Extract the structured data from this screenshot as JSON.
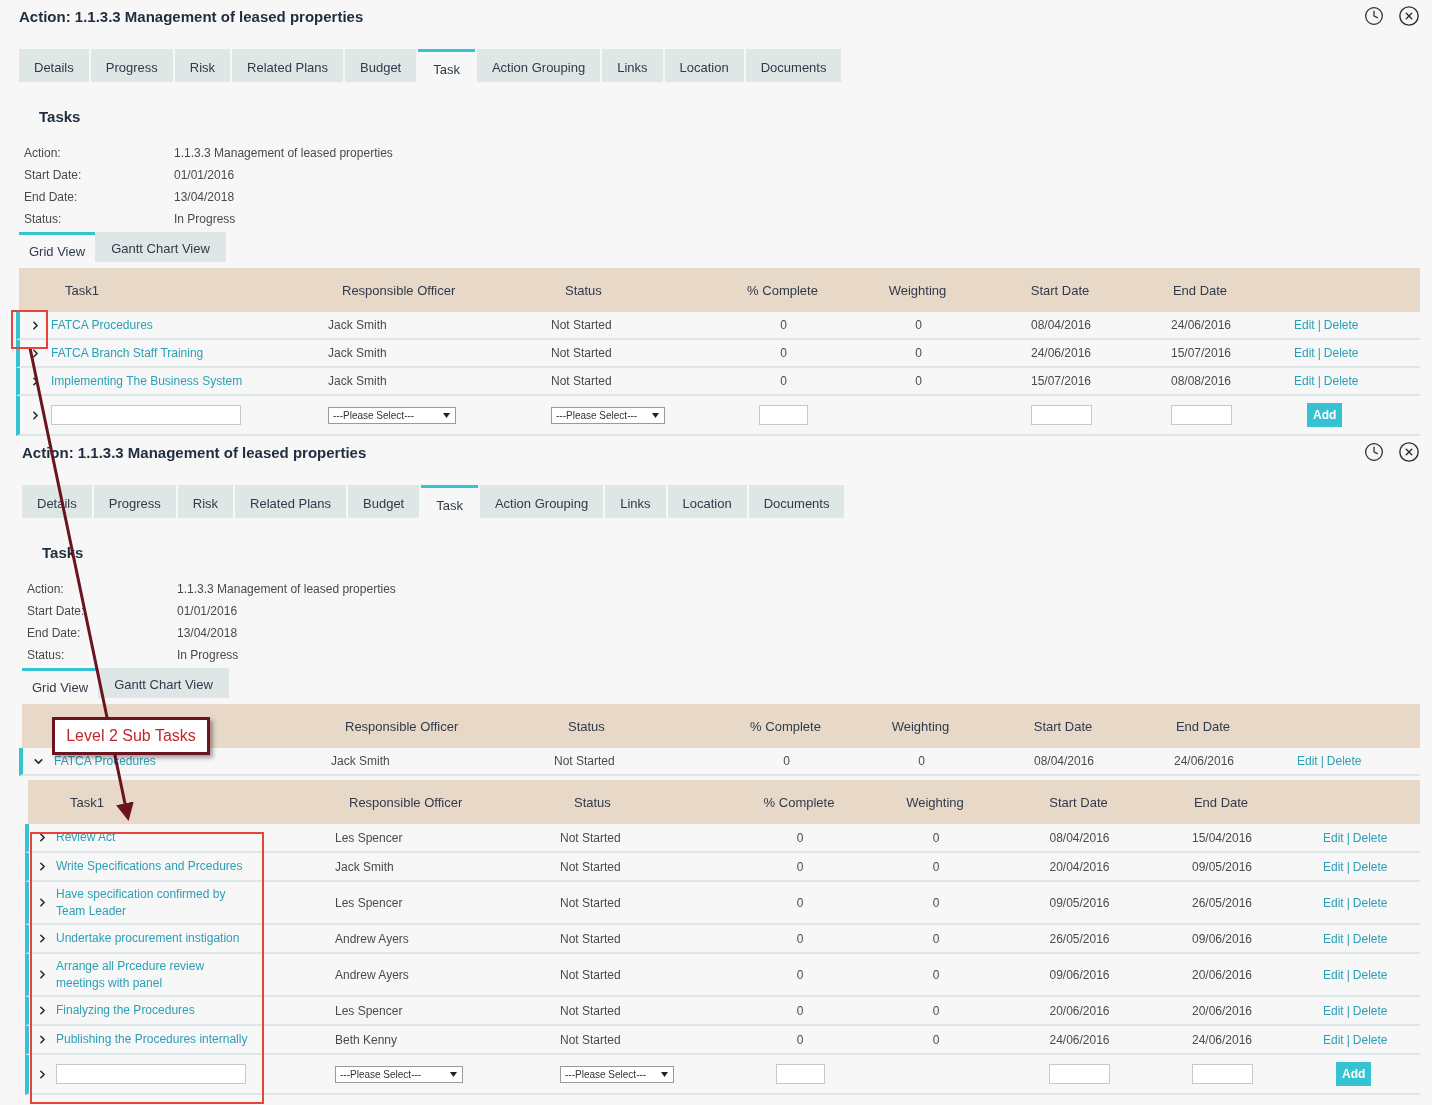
{
  "panels": [
    {
      "title": "Action: 1.1.3.3 Management of leased properties",
      "tabs": [
        {
          "label": "Details",
          "selected": false
        },
        {
          "label": "Progress",
          "selected": false
        },
        {
          "label": "Risk",
          "selected": false
        },
        {
          "label": "Related Plans",
          "selected": false
        },
        {
          "label": "Budget",
          "selected": false
        },
        {
          "label": "Task",
          "selected": true
        },
        {
          "label": "Action Grouping",
          "selected": false
        },
        {
          "label": "Links",
          "selected": false
        },
        {
          "label": "Location",
          "selected": false
        },
        {
          "label": "Documents",
          "selected": false
        }
      ],
      "section_title": "Tasks",
      "info": [
        {
          "label": "Action:",
          "value": "1.1.3.3 Management of leased properties"
        },
        {
          "label": "Start Date:",
          "value": "01/01/2016"
        },
        {
          "label": "End Date:",
          "value": "13/04/2018"
        },
        {
          "label": "Status:",
          "value": "In Progress"
        }
      ],
      "view_tabs": [
        {
          "label": "Grid View",
          "selected": true
        },
        {
          "label": "Gantt Chart View",
          "selected": false
        }
      ],
      "table": {
        "name_column": "Task1",
        "columns": [
          "Responsible Officer",
          "Status",
          "% Complete",
          "Weighting",
          "Start Date",
          "End Date"
        ],
        "rows": [
          {
            "name": "FATCA Procedures",
            "officer": "Jack Smith",
            "status": "Not Started",
            "complete": "0",
            "weighting": "0",
            "start": "08/04/2016",
            "end": "24/06/2016",
            "expanded": false,
            "actions": {
              "edit": "Edit",
              "separator": "|",
              "delete": "Delete"
            }
          },
          {
            "name": "FATCA Branch Staff Training",
            "officer": "Jack Smith",
            "status": "Not Started",
            "complete": "0",
            "weighting": "0",
            "start": "24/06/2016",
            "end": "15/07/2016",
            "expanded": false,
            "actions": {
              "edit": "Edit",
              "separator": "|",
              "delete": "Delete"
            }
          },
          {
            "name": "Implementing The Business System",
            "officer": "Jack Smith",
            "status": "Not Started",
            "complete": "0",
            "weighting": "0",
            "start": "15/07/2016",
            "end": "08/08/2016",
            "expanded": false,
            "actions": {
              "edit": "Edit",
              "separator": "|",
              "delete": "Delete"
            }
          }
        ],
        "new_row": {
          "expanded": false,
          "officer_select": "---Please Select---",
          "status_select": "---Please Select---",
          "button": "Add"
        }
      }
    },
    {
      "title": "Action: 1.1.3.3 Management of leased properties",
      "tabs": [
        {
          "label": "Details",
          "selected": false
        },
        {
          "label": "Progress",
          "selected": false
        },
        {
          "label": "Risk",
          "selected": false
        },
        {
          "label": "Related Plans",
          "selected": false
        },
        {
          "label": "Budget",
          "selected": false
        },
        {
          "label": "Task",
          "selected": true
        },
        {
          "label": "Action Grouping",
          "selected": false
        },
        {
          "label": "Links",
          "selected": false
        },
        {
          "label": "Location",
          "selected": false
        },
        {
          "label": "Documents",
          "selected": false
        }
      ],
      "section_title": "Tasks",
      "info": [
        {
          "label": "Action:",
          "value": "1.1.3.3 Management of leased properties"
        },
        {
          "label": "Start Date:",
          "value": "01/01/2016"
        },
        {
          "label": "End Date:",
          "value": "13/04/2018"
        },
        {
          "label": "Status:",
          "value": "In Progress"
        }
      ],
      "view_tabs": [
        {
          "label": "Grid View",
          "selected": true
        },
        {
          "label": "Gantt Chart View",
          "selected": false
        }
      ],
      "table": {
        "columns": [
          "Responsible Officer",
          "Status",
          "% Complete",
          "Weighting",
          "Start Date",
          "End Date"
        ],
        "rows": [
          {
            "name": "FATCA Procedures",
            "officer": "Jack Smith",
            "status": "Not Started",
            "complete": "0",
            "weighting": "0",
            "start": "08/04/2016",
            "end": "24/06/2016",
            "expanded": true,
            "actions": {
              "edit": "Edit",
              "separator": "|",
              "delete": "Delete"
            },
            "subtable": {
              "name_column": "Task1",
              "columns": [
                "Responsible Officer",
                "Status",
                "% Complete",
                "Weighting",
                "Start Date",
                "End Date"
              ],
              "rows": [
                {
                  "name": "Review Act",
                  "officer": "Les Spencer",
                  "status": "Not Started",
                  "complete": "0",
                  "weighting": "0",
                  "start": "08/04/2016",
                  "end": "15/04/2016",
                  "expanded": false,
                  "actions": {
                    "edit": "Edit",
                    "separator": "|",
                    "delete": "Delete"
                  }
                },
                {
                  "name": "Write Specifications and Prcedures",
                  "officer": "Jack Smith",
                  "status": "Not Started",
                  "complete": "0",
                  "weighting": "0",
                  "start": "20/04/2016",
                  "end": "09/05/2016",
                  "expanded": false,
                  "actions": {
                    "edit": "Edit",
                    "separator": "|",
                    "delete": "Delete"
                  }
                },
                {
                  "name": "Have specification confirmed by Team Leader",
                  "officer": "Les Spencer",
                  "status": "Not Started",
                  "complete": "0",
                  "weighting": "0",
                  "start": "09/05/2016",
                  "end": "26/05/2016",
                  "expanded": false,
                  "actions": {
                    "edit": "Edit",
                    "separator": "|",
                    "delete": "Delete"
                  }
                },
                {
                  "name": "Undertake procurement instigation",
                  "officer": "Andrew Ayers",
                  "status": "Not Started",
                  "complete": "0",
                  "weighting": "0",
                  "start": "26/05/2016",
                  "end": "09/06/2016",
                  "expanded": false,
                  "actions": {
                    "edit": "Edit",
                    "separator": "|",
                    "delete": "Delete"
                  }
                },
                {
                  "name": "Arrange all Prcedure review meetings with panel",
                  "officer": "Andrew Ayers",
                  "status": "Not Started",
                  "complete": "0",
                  "weighting": "0",
                  "start": "09/06/2016",
                  "end": "20/06/2016",
                  "expanded": false,
                  "actions": {
                    "edit": "Edit",
                    "separator": "|",
                    "delete": "Delete"
                  }
                },
                {
                  "name": "Finalyzing the Procedures",
                  "officer": "Les Spencer",
                  "status": "Not Started",
                  "complete": "0",
                  "weighting": "0",
                  "start": "20/06/2016",
                  "end": "20/06/2016",
                  "expanded": false,
                  "actions": {
                    "edit": "Edit",
                    "separator": "|",
                    "delete": "Delete"
                  }
                },
                {
                  "name": "Publishing the Procedures internally",
                  "officer": "Beth Kenny",
                  "status": "Not Started",
                  "complete": "0",
                  "weighting": "0",
                  "start": "24/06/2016",
                  "end": "24/06/2016",
                  "expanded": false,
                  "actions": {
                    "edit": "Edit",
                    "separator": "|",
                    "delete": "Delete"
                  }
                }
              ],
              "new_row": {
                "expanded": false,
                "officer_select": "---Please Select---",
                "status_select": "---Please Select---",
                "button": "Add"
              }
            }
          }
        ]
      }
    }
  ],
  "annotation": {
    "callout": "Level 2 Sub Tasks"
  }
}
